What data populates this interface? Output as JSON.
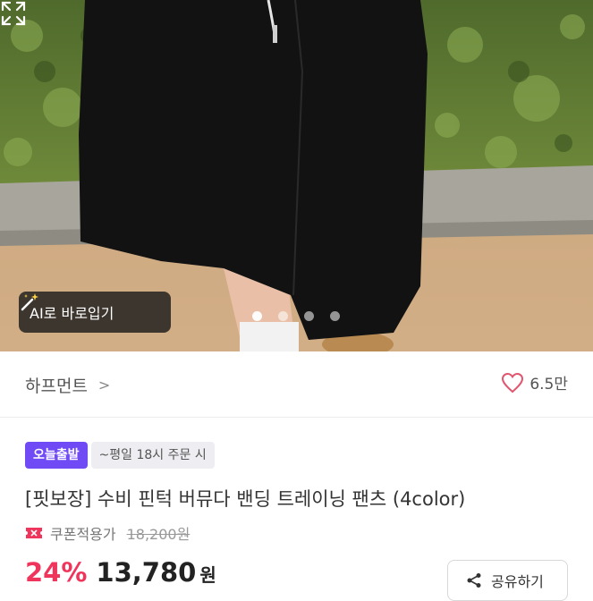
{
  "photo": {
    "ai_button_label": "AI로 바로입기",
    "carousel_dots": 4,
    "active_dot": 1
  },
  "store": {
    "name": "하프먼트",
    "chevron": ">",
    "likes": "6.5만"
  },
  "badges": {
    "today": "오늘출발",
    "time": "~평일 18시 주문 시"
  },
  "product": {
    "title": "[핏보장] 수비 핀턱 버뮤다 밴딩 트레이닝 팬츠 (4color)",
    "coupon_label": "쿠폰적용가",
    "original_price": "18,200원",
    "discount": "24%",
    "price": "13,780",
    "currency": "원"
  },
  "share": {
    "label": "공유하기"
  },
  "colors": {
    "accent_pink": "#f0355c",
    "badge_purple": "#6f4af5",
    "heart": "#e0566f"
  }
}
